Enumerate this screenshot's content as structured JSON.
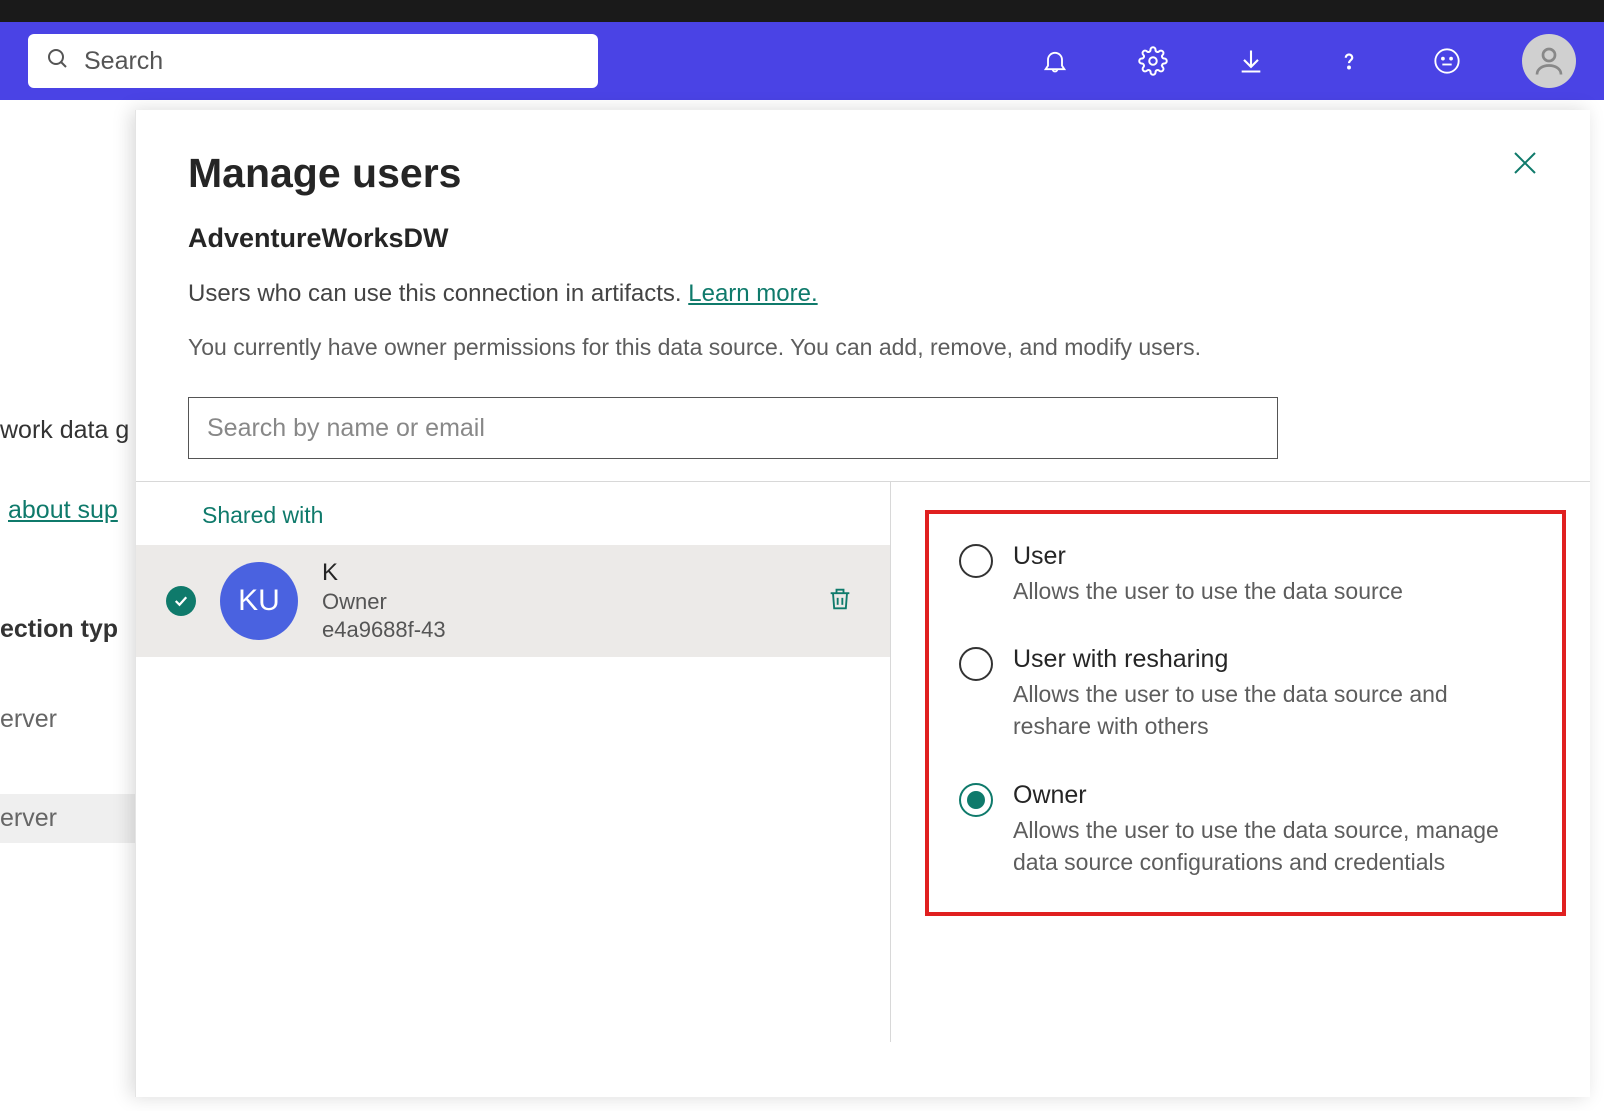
{
  "header": {
    "search_placeholder": "Search"
  },
  "background": {
    "frag1": "work data g",
    "frag2_link": "about sup",
    "frag3": "ection typ",
    "frag4": "erver",
    "frag5": "erver"
  },
  "panel": {
    "title": "Manage users",
    "subtitle": "AdventureWorksDW",
    "description_prefix": "Users who can use this connection in artifacts. ",
    "learn_more": "Learn more.",
    "permissions_note": "You currently have owner permissions for this data source. You can add, remove, and modify users.",
    "search_placeholder": "Search by name or email",
    "tab_shared_with": "Shared with",
    "user": {
      "initials": "KU",
      "name": "K",
      "role": "Owner",
      "id": "e4a9688f-43"
    },
    "roles": [
      {
        "key": "user",
        "title": "User",
        "desc": "Allows the user to use the data source",
        "selected": false
      },
      {
        "key": "user-resharing",
        "title": "User with resharing",
        "desc": "Allows the user to use the data source and reshare with others",
        "selected": false
      },
      {
        "key": "owner",
        "title": "Owner",
        "desc": "Allows the user to use the data source, manage data source configurations and credentials",
        "selected": true
      }
    ]
  }
}
